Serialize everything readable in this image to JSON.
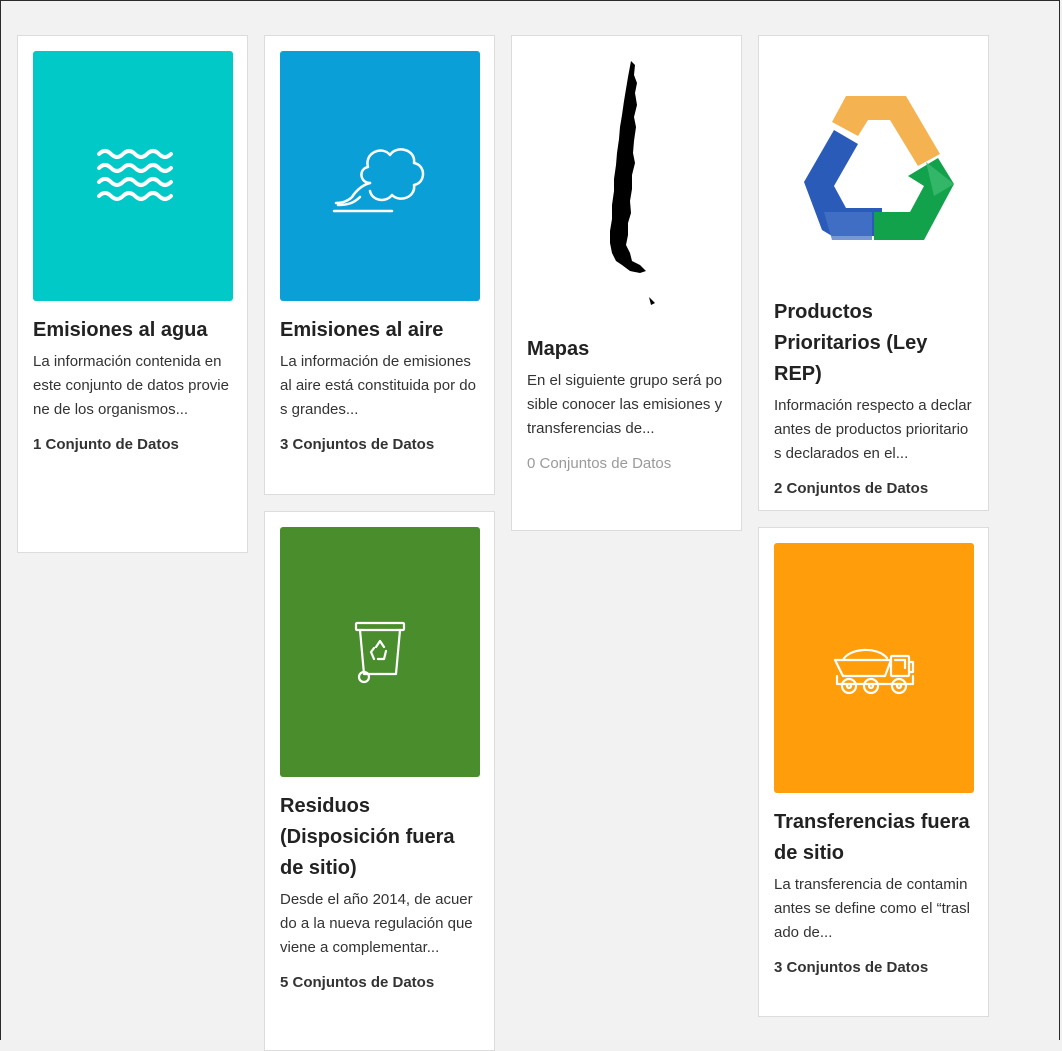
{
  "colors": {
    "agua": "#00c9c8",
    "aire": "#0aa0d7",
    "residuos": "#4a8d2c",
    "transferencias": "#ff9d0a",
    "recycle_orange": "#f5b251",
    "recycle_blue": "#2a5bb8",
    "recycle_green": "#12a24b"
  },
  "cards": [
    {
      "icon": "waves-icon",
      "title": "Emisiones al agua",
      "description": "La información contenida en este conjunto de datos proviene de los organismos...",
      "count": "1 Conjunto de Datos"
    },
    {
      "icon": "cloud-smoke-icon",
      "title": "Emisiones al aire",
      "description": "La información de emisiones al aire está constituida por dos grandes...",
      "count": "3 Conjuntos de Datos"
    },
    {
      "icon": "chile-map-icon",
      "title": "Mapas",
      "description": "En el siguiente grupo será posible conocer las emisiones y transferencias de...",
      "count": "0 Conjuntos de Datos"
    },
    {
      "icon": "recycle-icon",
      "title": "Productos Prioritarios (Ley REP)",
      "description": "Información respecto a declarantes de productos prioritarios declarados en el...",
      "count": "2 Conjuntos de Datos"
    },
    {
      "icon": "recycle-bin-icon",
      "title": "Residuos (Disposición fuera de sitio)",
      "description": "Desde el año 2014, de acuerdo a la nueva regulación que viene a complementar...",
      "count": "5 Conjuntos de Datos"
    },
    {
      "icon": "dump-truck-icon",
      "title": "Transferencias fuera de sitio",
      "description": "La transferencia de contaminantes se define como el “traslado de...",
      "count": "3 Conjuntos de Datos"
    }
  ]
}
